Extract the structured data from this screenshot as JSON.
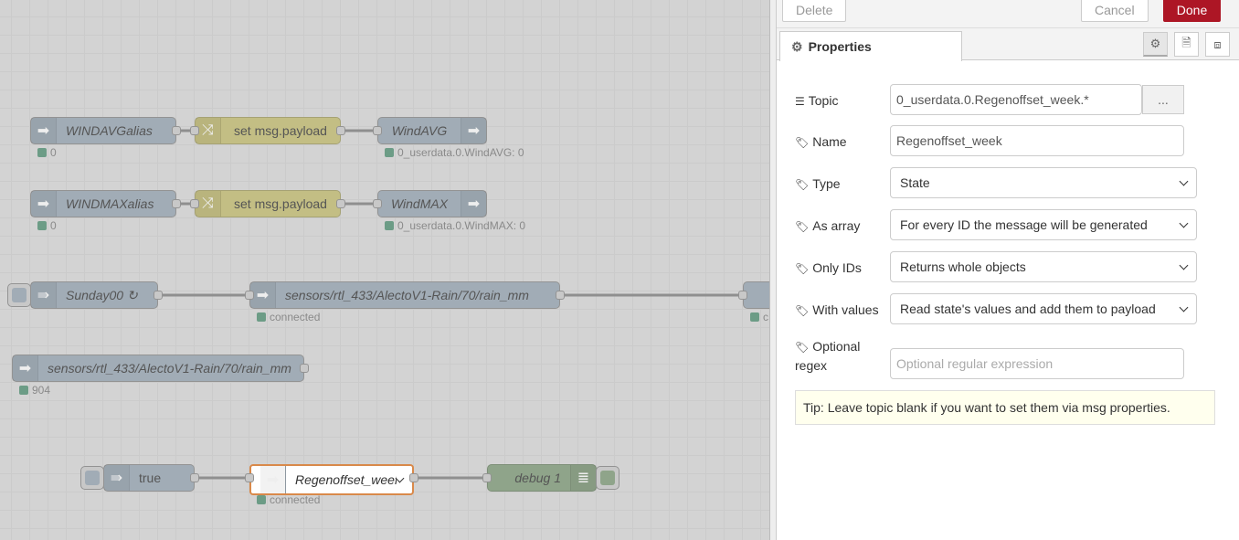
{
  "canvas": {
    "nodes": [
      {
        "label": "WINDAVGalias",
        "status": "0"
      },
      {
        "label": "set msg.payload"
      },
      {
        "label": "WindAVG",
        "status": "0_userdata.0.WindAVG: 0"
      },
      {
        "label": "WINDMAXalias",
        "status": "0"
      },
      {
        "label": "set msg.payload"
      },
      {
        "label": "WindMAX",
        "status": "0_userdata.0.WindMAX: 0"
      },
      {
        "label": "Sunday00 ↻"
      },
      {
        "label": "sensors/rtl_433/AlectoV1-Rain/70/rain_mm",
        "status": "connected"
      },
      {
        "label": "",
        "status": "c"
      },
      {
        "label": "sensors/rtl_433/AlectoV1-Rain/70/rain_mm",
        "status": "904"
      },
      {
        "label": "true"
      },
      {
        "label": "Regenoffset_week",
        "status": "connected"
      },
      {
        "label": "debug 1"
      }
    ],
    "colors": {
      "selected_border": "#d9894a",
      "change_node": "#c3be84",
      "debug_node": "#8fa48a",
      "status_ok": "#6c9c86"
    }
  },
  "panel": {
    "delete_label": "Delete",
    "cancel_label": "Cancel",
    "done_label": "Done",
    "tab_label": "Properties",
    "icons": [
      "cog-icon",
      "file-text-icon",
      "frame-icon"
    ],
    "fields": {
      "topic": {
        "label": "Topic",
        "value": "0_userdata.0.Regenoffset_week.*",
        "browse": "..."
      },
      "name": {
        "label": "Name",
        "value": "Regenoffset_week"
      },
      "type": {
        "label": "Type",
        "value": "State"
      },
      "as_array": {
        "label": "As array",
        "value": "For every ID the message will be generated"
      },
      "only_ids": {
        "label": "Only IDs",
        "value": "Returns whole objects"
      },
      "with_values": {
        "label": "With values",
        "value": "Read state's values and add them to payload"
      },
      "regex": {
        "label_1": "Optional",
        "label_2": "regex",
        "placeholder": "Optional regular expression"
      }
    },
    "tip": "Tip: Leave topic blank if you want to set them via msg properties.",
    "done_color": "#ad1625"
  }
}
